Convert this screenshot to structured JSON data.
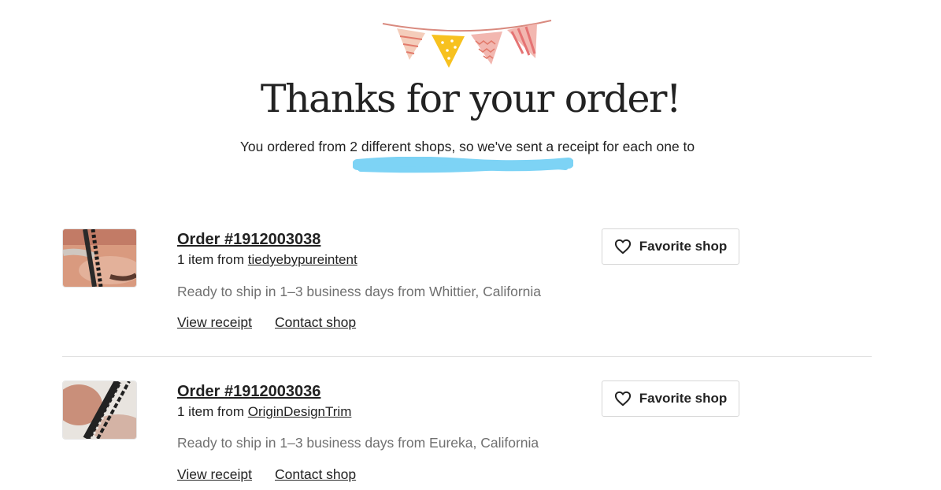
{
  "page": {
    "headline": "Thanks for your order!",
    "subtext": "You ordered from 2 different shops, so we've sent a receipt for each one to"
  },
  "orders": [
    {
      "order_number": "Order #1912003038",
      "items_prefix": "1 item from ",
      "shop_name": "tiedyebypureintent",
      "shipping": "Ready to ship in 1–3 business days from Whittier, California",
      "view_receipt": "View receipt",
      "contact_shop": "Contact shop",
      "favorite_label": "Favorite shop"
    },
    {
      "order_number": "Order #1912003036",
      "items_prefix": "1 item from ",
      "shop_name": "OriginDesignTrim",
      "shipping": "Ready to ship in 1–3 business days from Eureka, California",
      "view_receipt": "View receipt",
      "contact_shop": "Contact shop",
      "favorite_label": "Favorite shop"
    }
  ],
  "icons": {
    "bunting": "bunting-flags-icon",
    "favorite": "heart-outline-icon"
  },
  "colors": {
    "text": "#222222",
    "muted": "#707070",
    "redaction": "#7dd3f5",
    "flag_pink": "#f4cdbb",
    "flag_yellow": "#f7c11f",
    "flag_rose": "#e9a6a0",
    "flag_red": "#e57373"
  }
}
